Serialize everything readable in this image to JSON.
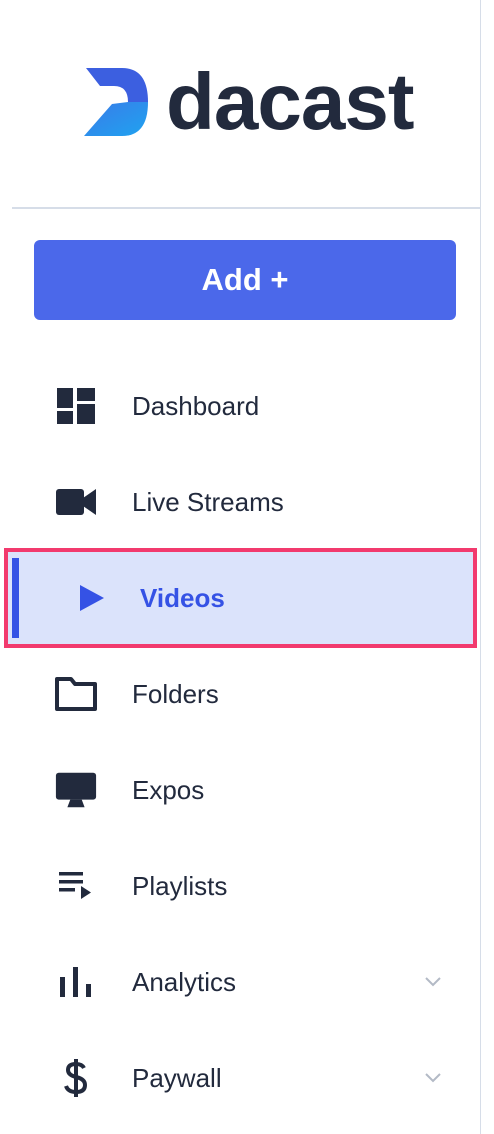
{
  "brand": {
    "name": "dacast"
  },
  "add_button": {
    "label": "Add +"
  },
  "nav": {
    "items": [
      {
        "id": "dashboard",
        "label": "Dashboard",
        "icon": "dashboard-icon"
      },
      {
        "id": "live-streams",
        "label": "Live Streams",
        "icon": "video-camera-icon"
      },
      {
        "id": "videos",
        "label": "Videos",
        "icon": "play-icon",
        "active": true
      },
      {
        "id": "folders",
        "label": "Folders",
        "icon": "folder-icon"
      },
      {
        "id": "expos",
        "label": "Expos",
        "icon": "monitor-icon"
      },
      {
        "id": "playlists",
        "label": "Playlists",
        "icon": "playlist-icon"
      },
      {
        "id": "analytics",
        "label": "Analytics",
        "icon": "bar-chart-icon",
        "expandable": true
      },
      {
        "id": "paywall",
        "label": "Paywall",
        "icon": "dollar-icon",
        "expandable": true
      }
    ]
  },
  "colors": {
    "primary": "#4b68ea",
    "active_text": "#3552e5",
    "active_bg": "#dbe3fb",
    "highlight_border": "#f23a6e",
    "text": "#222a3d"
  }
}
